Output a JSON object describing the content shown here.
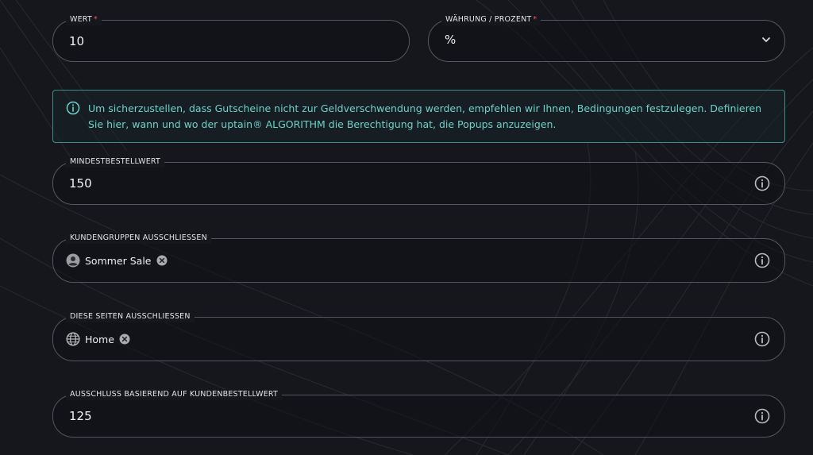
{
  "fields": {
    "wert": {
      "label": "WERT",
      "required_mark": "*",
      "value": "10"
    },
    "waehrung": {
      "label": "WÄHRUNG / PROZENT",
      "required_mark": "*",
      "value": "%"
    },
    "mindestbestellwert": {
      "label": "MINDESTBESTELLWERT",
      "value": "150"
    },
    "kundengruppen": {
      "label": "KUNDENGRUPPEN AUSSCHLIESSEN",
      "chips": [
        "Sommer Sale"
      ]
    },
    "seiten": {
      "label": "DIESE SEITEN AUSSCHLIESSEN",
      "chips": [
        "Home"
      ]
    },
    "kundenbestellwert": {
      "label": "AUSSCHLUSS BASIEREND AUF KUNDENBESTELLWERT",
      "value": "125"
    }
  },
  "alert": {
    "text": "Um sicherzustellen, dass Gutscheine nicht zur Geldverschwendung werden, empfehlen wir Ihnen, Bedingungen festzulegen. Definieren Sie hier, wann und wo der uptain® ALGORITHM die Berechtigung hat, die Popups anzuzeigen."
  },
  "icons": {
    "info": "info-circle-icon",
    "dropdown": "chevron-down-icon",
    "user_group": "user-circle-icon",
    "page": "globe-icon",
    "remove": "close-circle-icon"
  },
  "colors": {
    "background": "#16171c",
    "border": "#55575e",
    "alert_border": "#3a8d8a",
    "alert_text": "#6fd0cb",
    "required": "#e05a5a"
  }
}
